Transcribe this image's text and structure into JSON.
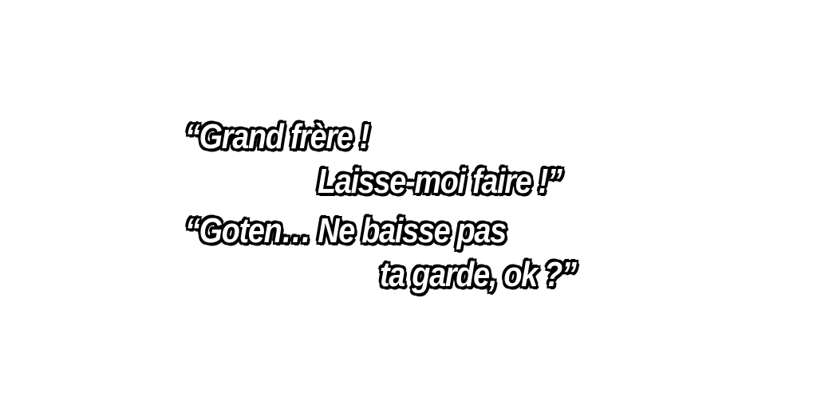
{
  "dialogue": {
    "line1": "“Grand frère !",
    "line2": "Laisse-moi faire !”",
    "line3": "“Goten… Ne baisse pas",
    "line4": "ta garde, ok ?”"
  },
  "colors": {
    "background": "#ffffff",
    "text_fill": "#ffffff",
    "text_outline": "#000000"
  }
}
